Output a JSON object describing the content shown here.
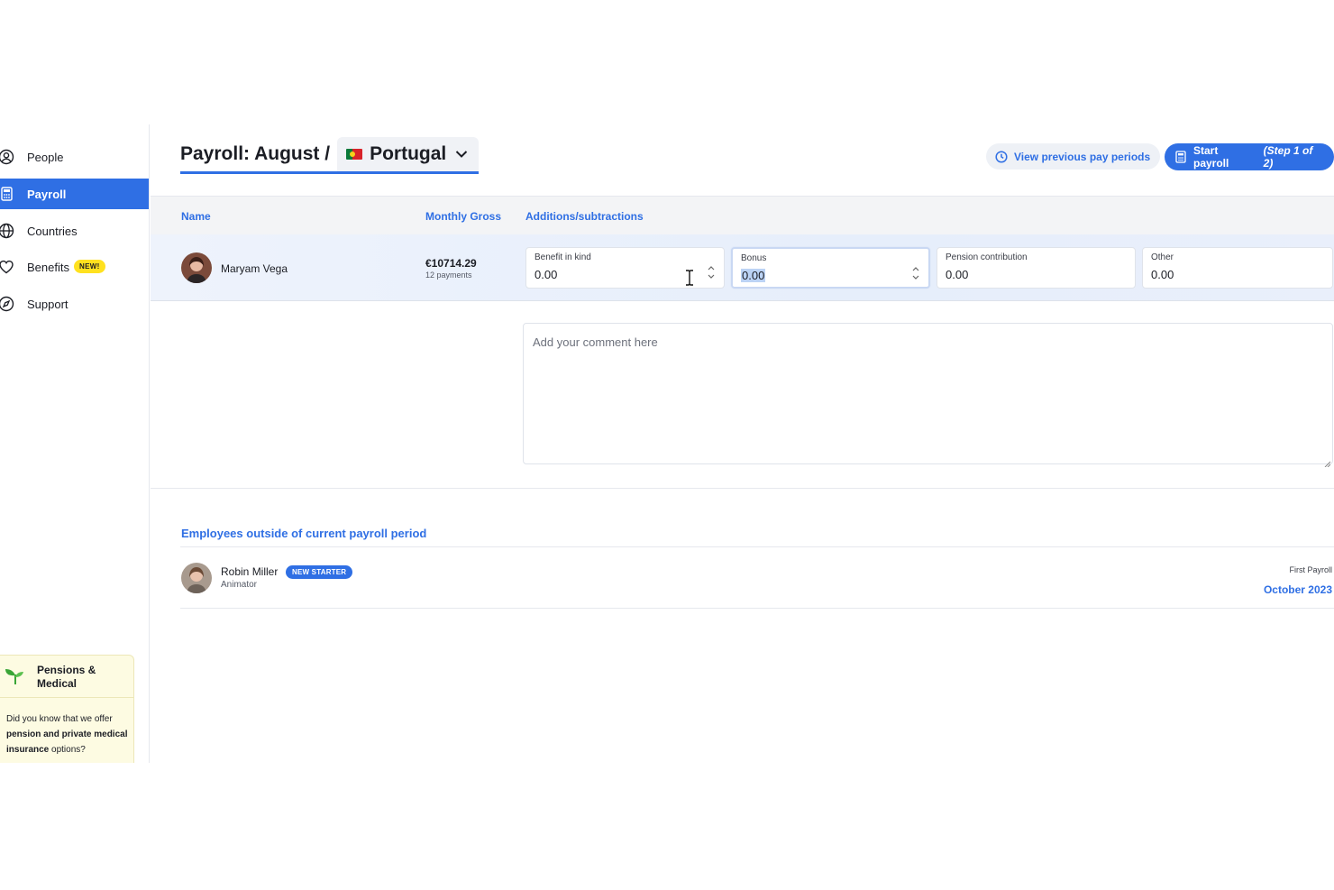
{
  "sidebar": {
    "items": [
      {
        "label": "People",
        "icon": "user-circle-icon"
      },
      {
        "label": "Payroll",
        "icon": "calculator-icon",
        "active": true
      },
      {
        "label": "Countries",
        "icon": "globe-icon"
      },
      {
        "label": "Benefits",
        "icon": "heart-icon",
        "badge": "NEW!"
      },
      {
        "label": "Support",
        "icon": "compass-icon"
      }
    ],
    "promo": {
      "title": "Pensions & Medical",
      "text_start": "Did you know that we offer ",
      "text_bold": "pension and private medical insurance",
      "text_end": " options?"
    }
  },
  "header": {
    "title": "Payroll: August /",
    "country": "Portugal",
    "view_previous_label": "View previous pay periods",
    "start_payroll_label": "Start payroll",
    "start_payroll_step": "(Step 1 of 2)"
  },
  "table": {
    "columns": {
      "name": "Name",
      "gross": "Monthly Gross",
      "additions": "Additions/subtractions"
    },
    "row": {
      "name": "Maryam Vega",
      "gross": "€10714.29",
      "gross_sub": "12 payments",
      "fields": [
        {
          "label": "Benefit in kind",
          "value": "0.00"
        },
        {
          "label": "Bonus",
          "value": "0.00"
        },
        {
          "label": "Pension contribution",
          "value": "0.00"
        },
        {
          "label": "Other",
          "value": "0.00"
        }
      ],
      "comment_placeholder": "Add your comment here"
    }
  },
  "outside": {
    "title": "Employees outside of current payroll period",
    "employee": {
      "name": "Robin Miller",
      "badge": "NEW STARTER",
      "role": "Animator",
      "first_payroll_label": "First Payroll",
      "first_payroll_value": "October 2023"
    }
  },
  "colors": {
    "accent": "#2f6fe4",
    "badge_yellow": "#ffe11f",
    "promo_bg": "#fdfbe2"
  }
}
